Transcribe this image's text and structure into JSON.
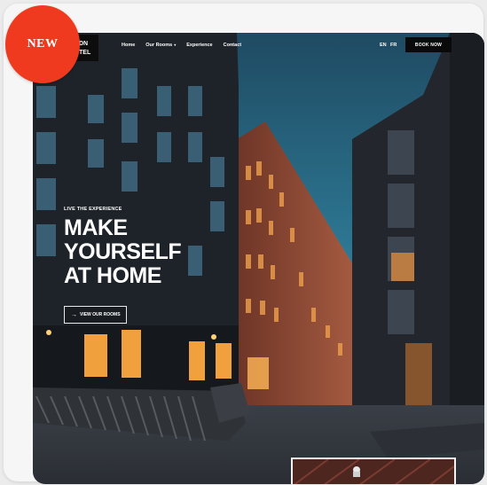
{
  "badge": {
    "label": "NEW"
  },
  "nav": {
    "logo_lines": [
      "DN",
      "TEL"
    ],
    "links": [
      "Home",
      "Our Rooms",
      "Experience",
      "Contact"
    ],
    "lang_en": "EN",
    "lang_fr": "FR",
    "book_label": "BOOK NOW"
  },
  "hero": {
    "eyebrow": "LIVE THE EXPERIENCE",
    "headline_lines": [
      "MAKE",
      "YOURSELF",
      "AT HOME"
    ],
    "cta_label": "VIEW OUR ROOMS"
  },
  "colors": {
    "badge": "#ef3a1f",
    "sky": "#2a6f8a",
    "building_dark": "#1f242b",
    "building_brick": "#8a4a38",
    "window_glow": "#f0a850"
  }
}
